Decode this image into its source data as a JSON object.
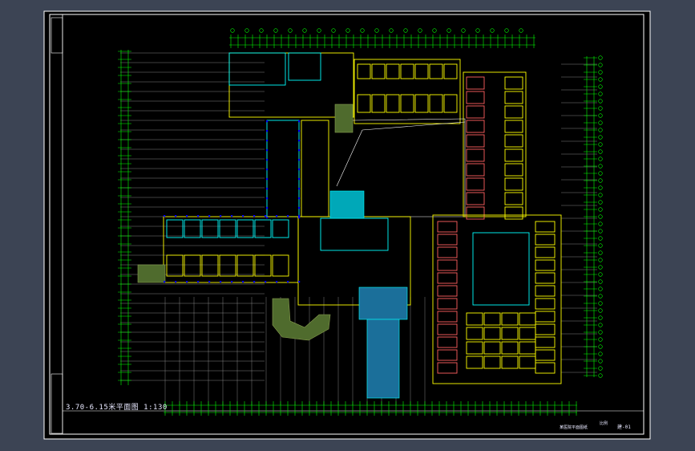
{
  "drawing": {
    "title": "3.70-6.15米平面图   1:130",
    "stamp": "某医院平面图纸",
    "scale_note": "比例",
    "sheet_no": "建-01"
  },
  "colors": {
    "outer_bg": "#3c4454",
    "paper": "#000000",
    "frame": "#ffffff",
    "wall": "#ffff00",
    "dimension": "#00ff00",
    "axis_line": "#ffffff",
    "room": "#00ffff",
    "column": "#0000ff",
    "stair": "#00c8c8",
    "ramp": "#6e8a3c",
    "text": "#e8e8ff",
    "accent": "#ff6060"
  }
}
